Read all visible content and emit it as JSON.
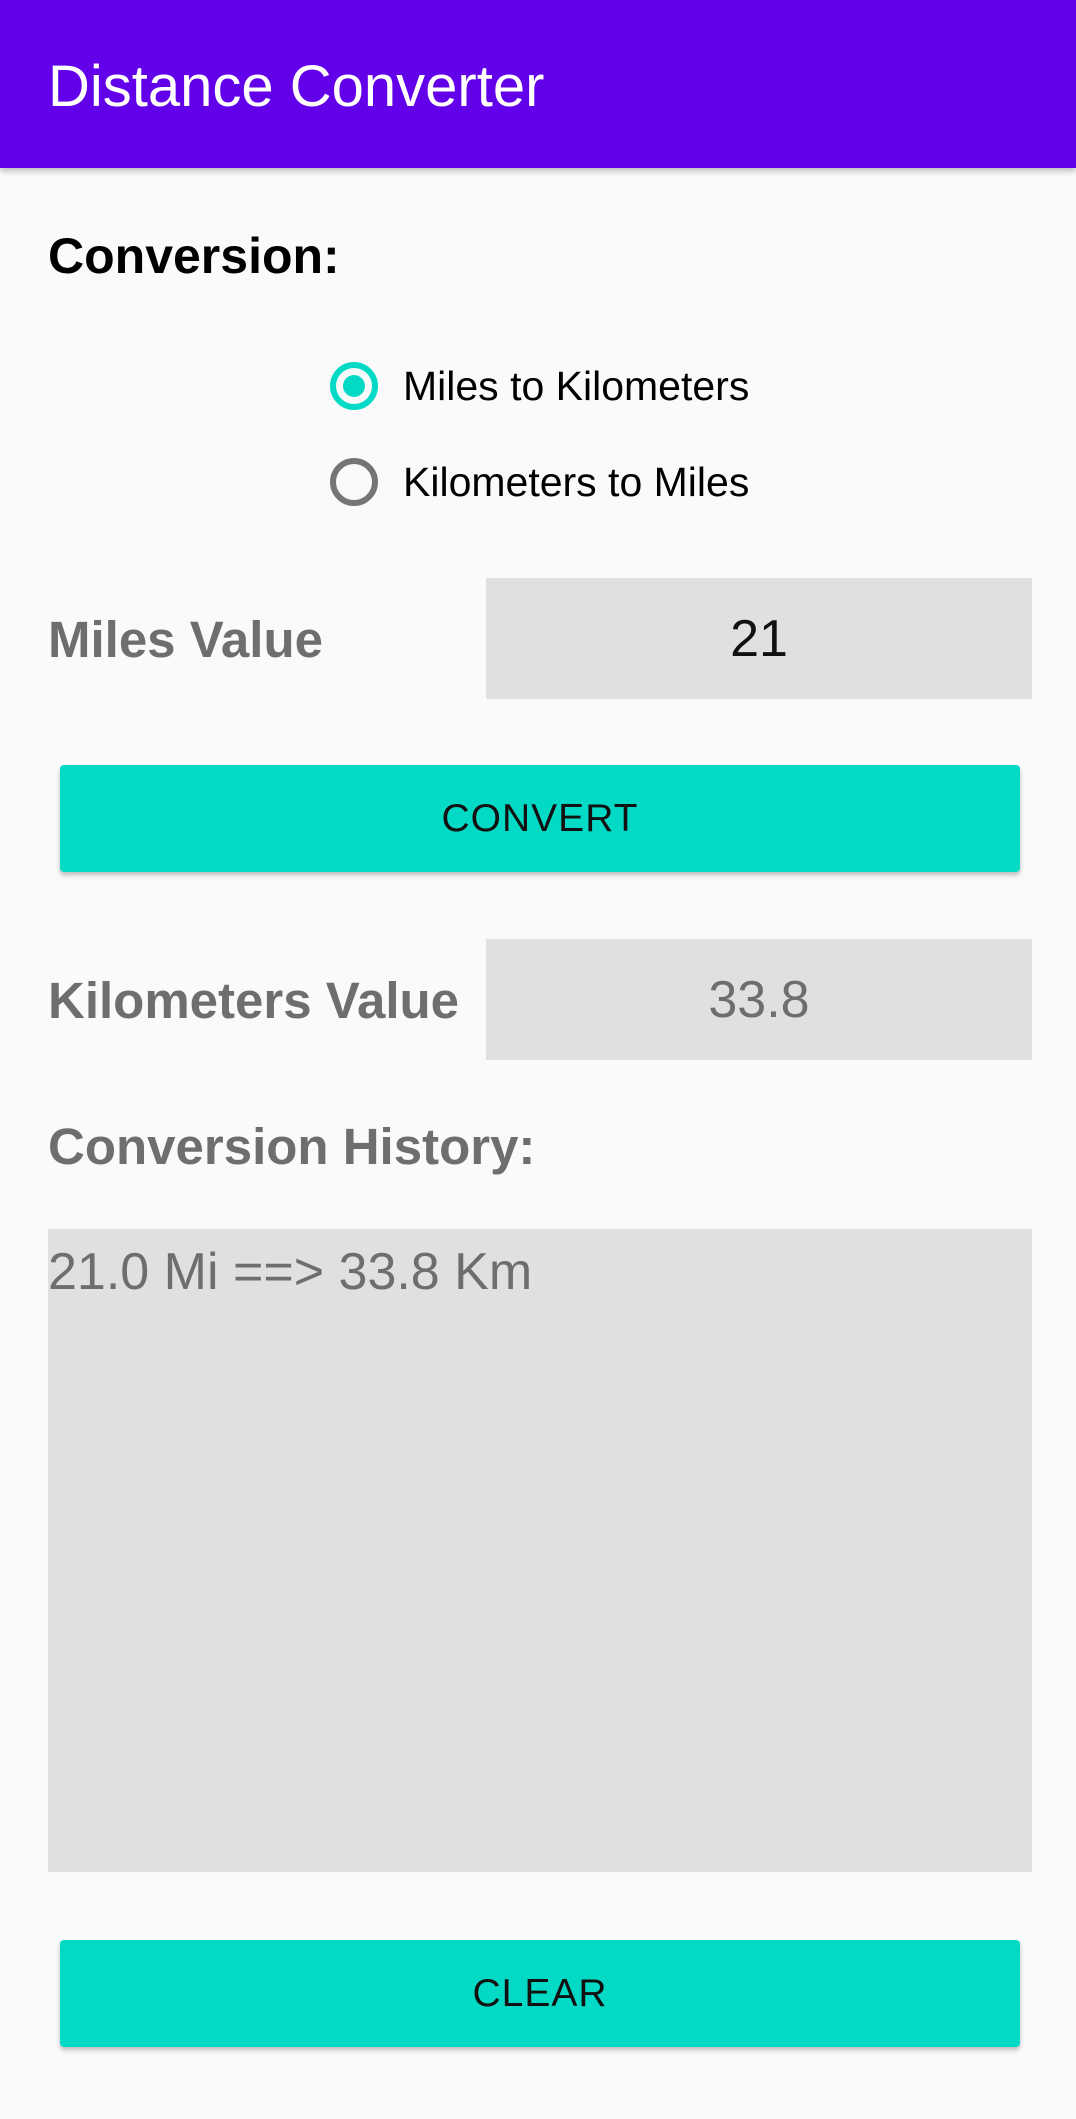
{
  "app_bar": {
    "title": "Distance Converter",
    "color": "#6200ea"
  },
  "conversion": {
    "label": "Conversion:",
    "options": [
      {
        "label": "Miles to Kilometers",
        "checked": true
      },
      {
        "label": "Kilometers to Miles",
        "checked": false
      }
    ],
    "accent_color": "#03dac5"
  },
  "input": {
    "label": "Miles Value",
    "value": "21"
  },
  "convert_button": {
    "label": "CONVERT"
  },
  "output": {
    "label": "Kilometers Value",
    "value": "33.8"
  },
  "history": {
    "label": "Conversion History:",
    "entries": [
      "21.0 Mi ==> 33.8 Km"
    ]
  },
  "clear_button": {
    "label": "CLEAR"
  }
}
